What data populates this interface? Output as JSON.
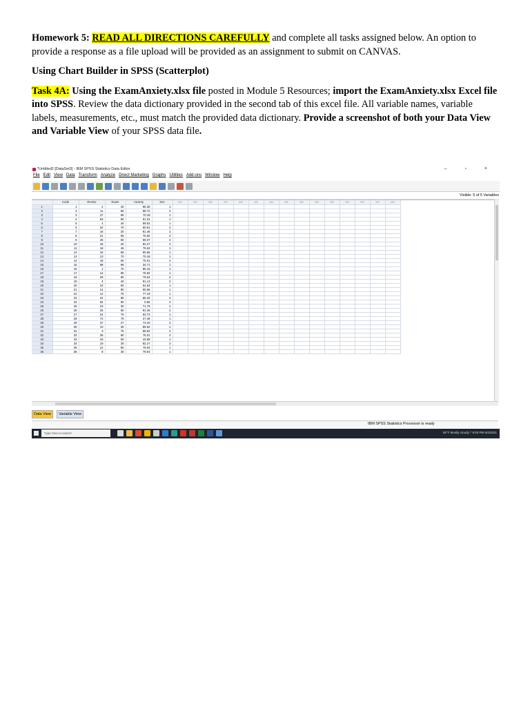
{
  "homework": {
    "lead": "Homework 5: ",
    "highlight": "READ ALL DIRECTIONS CAREFULLY",
    "rest": " and complete all tasks assigned below. An option to provide a response as a file upload will be provided as an assignment to submit on CANVAS."
  },
  "section_heading": "Using Chart Builder in SPSS (Scatterplot)",
  "task": {
    "label": "Task 4A:",
    "bold1": " Using the ExamAnxiety.xlsx file",
    "text1": " posted in Module 5 Resources; ",
    "bold2": "import the ExamAnxiety.xlsx Excel file into SPSS",
    "text2": ". Review the data dictionary provided in the second tab of this excel file. All variable names, variable labels, measurements, etc., must match the provided data dictionary. ",
    "bold3": "Provide a screenshot of both your Data View and Variable View",
    "text3": " of your SPSS data file",
    "bold4": "."
  },
  "spss": {
    "window_title": "*Untitled2 [DataSet3] - IBM SPSS Statistics Data Editor",
    "window_controls": "– ▫ ×",
    "menus": [
      "File",
      "Edit",
      "View",
      "Data",
      "Transform",
      "Analyze",
      "Direct Marketing",
      "Graphs",
      "Utilities",
      "Add-ons",
      "Window",
      "Help"
    ],
    "visible_label": "Visible: 5 of 5 Variables",
    "columns": [
      "Code",
      "Revise",
      "Exam",
      "Anxiety",
      "Sex"
    ],
    "empty_col_label": "var",
    "empty_col_count": 15,
    "rows": [
      [
        1,
        4,
        40,
        "86.30",
        1
      ],
      [
        2,
        11,
        65,
        "88.72",
        2
      ],
      [
        3,
        27,
        80,
        "70.18",
        1
      ],
      [
        4,
        53,
        80,
        "61.31",
        1
      ],
      [
        5,
        4,
        40,
        "89.52",
        1
      ],
      [
        6,
        22,
        70,
        "60.51",
        2
      ],
      [
        7,
        16,
        20,
        "81.46",
        2
      ],
      [
        8,
        21,
        55,
        "75.82",
        2
      ],
      [
        9,
        25,
        50,
        "69.37",
        2
      ],
      [
        10,
        18,
        40,
        "82.27",
        2
      ],
      [
        11,
        18,
        45,
        "79.04",
        1
      ],
      [
        12,
        16,
        85,
        "80.65",
        1
      ],
      [
        13,
        13,
        70,
        "70.18",
        1
      ],
      [
        14,
        18,
        50,
        "75.01",
        2
      ],
      [
        15,
        98,
        95,
        "34.71",
        1
      ],
      [
        16,
        1,
        70,
        "95.16",
        1
      ],
      [
        17,
        14,
        95,
        "75.82",
        1
      ],
      [
        18,
        29,
        80,
        "79.04",
        2
      ],
      [
        19,
        4,
        40,
        "91.13",
        2
      ],
      [
        20,
        23,
        60,
        "64.54",
        1
      ],
      [
        21,
        14,
        80,
        "80.65",
        1
      ],
      [
        22,
        12,
        75,
        "77.43",
        1
      ],
      [
        23,
        22,
        85,
        "65.34",
        2
      ],
      [
        24,
        84,
        90,
        "0.56",
        2
      ],
      [
        25,
        23,
        30,
        "71.79",
        2
      ],
      [
        26,
        26,
        60,
        "81.46",
        2
      ],
      [
        27,
        24,
        75,
        "63.73",
        1
      ],
      [
        28,
        72,
        75,
        "27.48",
        1
      ],
      [
        29,
        37,
        27,
        "73.40",
        2
      ],
      [
        30,
        10,
        30,
        "89.52",
        1
      ],
      [
        31,
        3,
        75,
        "89.52",
        2
      ],
      [
        32,
        36,
        90,
        "75.01",
        2
      ],
      [
        33,
        43,
        60,
        "43.58",
        1
      ],
      [
        34,
        19,
        30,
        "82.27",
        2
      ],
      [
        35,
        12,
        80,
        "79.04",
        1
      ],
      [
        36,
        9,
        30,
        "79.04",
        1
      ]
    ],
    "tabs": [
      "Data View",
      "Variable View"
    ],
    "status": "IBM SPSS Statistics Processor is ready",
    "taskbar_search": "Type here to search",
    "tray": "59°F Mostly cloudy  ^  9:00 PM  6/4/2021"
  }
}
